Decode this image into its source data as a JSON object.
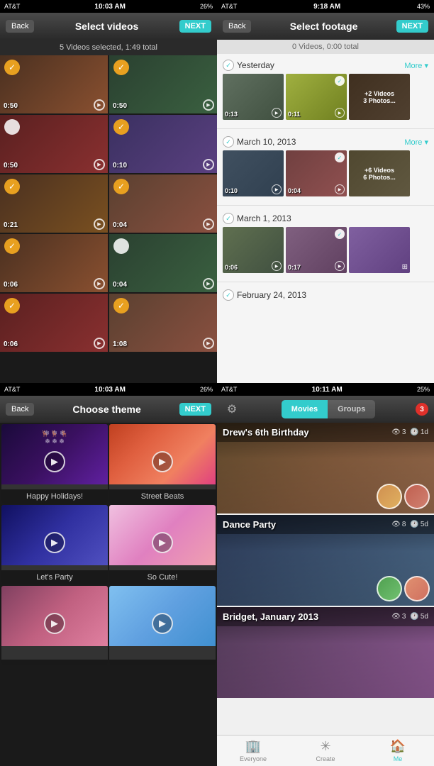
{
  "panel1": {
    "status": {
      "carrier": "AT&T",
      "time": "10:03 AM",
      "battery": "26%"
    },
    "nav": {
      "back": "Back",
      "title": "Select videos",
      "next": "NEXT"
    },
    "subtitle": "5 Videos selected, 1:49 total",
    "videos": [
      {
        "duration": "0:50",
        "selected": true,
        "bg": "vt1"
      },
      {
        "duration": "0:50",
        "selected": true,
        "bg": "vt2"
      },
      {
        "duration": "0:50",
        "selected": false,
        "bg": "vt3"
      },
      {
        "duration": "0:10",
        "selected": true,
        "bg": "vt4"
      },
      {
        "duration": "0:21",
        "selected": true,
        "bg": "vt5"
      },
      {
        "duration": "0:04",
        "selected": false,
        "bg": "vt6"
      },
      {
        "duration": "0:06",
        "selected": true,
        "bg": "vt1"
      },
      {
        "duration": "0:04",
        "selected": false,
        "bg": "vt2"
      },
      {
        "duration": "0:06",
        "selected": false,
        "bg": "vt3"
      },
      {
        "duration": "1:08",
        "selected": true,
        "bg": "vt6"
      }
    ]
  },
  "panel2": {
    "status": {
      "carrier": "AT&T",
      "time": "9:18 AM",
      "battery": "43%"
    },
    "nav": {
      "back": "Back",
      "title": "Select footage",
      "next": "NEXT"
    },
    "subtitle": "0 Videos, 0:00 total",
    "sections": [
      {
        "date": "Yesterday",
        "more_label": "More",
        "thumbs": [
          {
            "duration": "0:13",
            "has_play": true,
            "bg": "ft1"
          },
          {
            "duration": "0:11",
            "has_play": true,
            "bg": "ft2",
            "checked": true
          },
          {
            "more_videos": "+2 Videos",
            "more_photos": "3 Photos...",
            "bg": "ft3"
          }
        ]
      },
      {
        "date": "March 10, 2013",
        "more_label": "More",
        "thumbs": [
          {
            "duration": "0:10",
            "has_play": true,
            "bg": "ft4"
          },
          {
            "duration": "0:04",
            "has_play": true,
            "bg": "ft5",
            "checked": true
          },
          {
            "more_videos": "+6 Videos",
            "more_photos": "6 Photos...",
            "bg": "ft6"
          }
        ]
      },
      {
        "date": "March 1, 2013",
        "thumbs": [
          {
            "duration": "0:06",
            "has_play": true,
            "bg": "ft7"
          },
          {
            "duration": "0:17",
            "has_play": true,
            "bg": "ft8",
            "checked": true
          },
          {
            "bg": "ft9",
            "is_photo": true
          }
        ]
      },
      {
        "date": "February 24, 2013",
        "thumbs": []
      }
    ]
  },
  "panel3": {
    "status": {
      "carrier": "AT&T",
      "time": "10:03 AM",
      "battery": "26%"
    },
    "nav": {
      "back": "Back",
      "title": "Choose theme",
      "next": "NEXT"
    },
    "themes": [
      {
        "label": "Happy Holidays!",
        "bg": "theme-happy"
      },
      {
        "label": "Street Beats",
        "bg": "theme-street"
      },
      {
        "label": "Let's Party",
        "bg": "theme-party"
      },
      {
        "label": "So Cute!",
        "bg": "theme-cute"
      },
      {
        "label": "",
        "bg": "theme-love"
      },
      {
        "label": "",
        "bg": "theme-sky"
      }
    ]
  },
  "panel4": {
    "status": {
      "carrier": "AT&T",
      "time": "10:11 AM",
      "battery": "25%"
    },
    "tabs": {
      "movies": "Movies",
      "groups": "Groups",
      "badge": "3"
    },
    "movies": [
      {
        "title": "Drew's 6th Birthday",
        "views": "3",
        "days": "1d",
        "bg": "movie-bg-1",
        "avatars": [
          "av1",
          "av2"
        ]
      },
      {
        "title": "Dance Party",
        "views": "8",
        "days": "5d",
        "bg": "movie-bg-2",
        "avatars": [
          "av3",
          "av4"
        ]
      },
      {
        "title": "Bridget, January 2013",
        "views": "3",
        "days": "5d",
        "bg": "movie-bg-3",
        "avatars": []
      }
    ],
    "tabbar": {
      "everyone_label": "Everyone",
      "create_label": "Create",
      "me_label": "Me"
    }
  }
}
